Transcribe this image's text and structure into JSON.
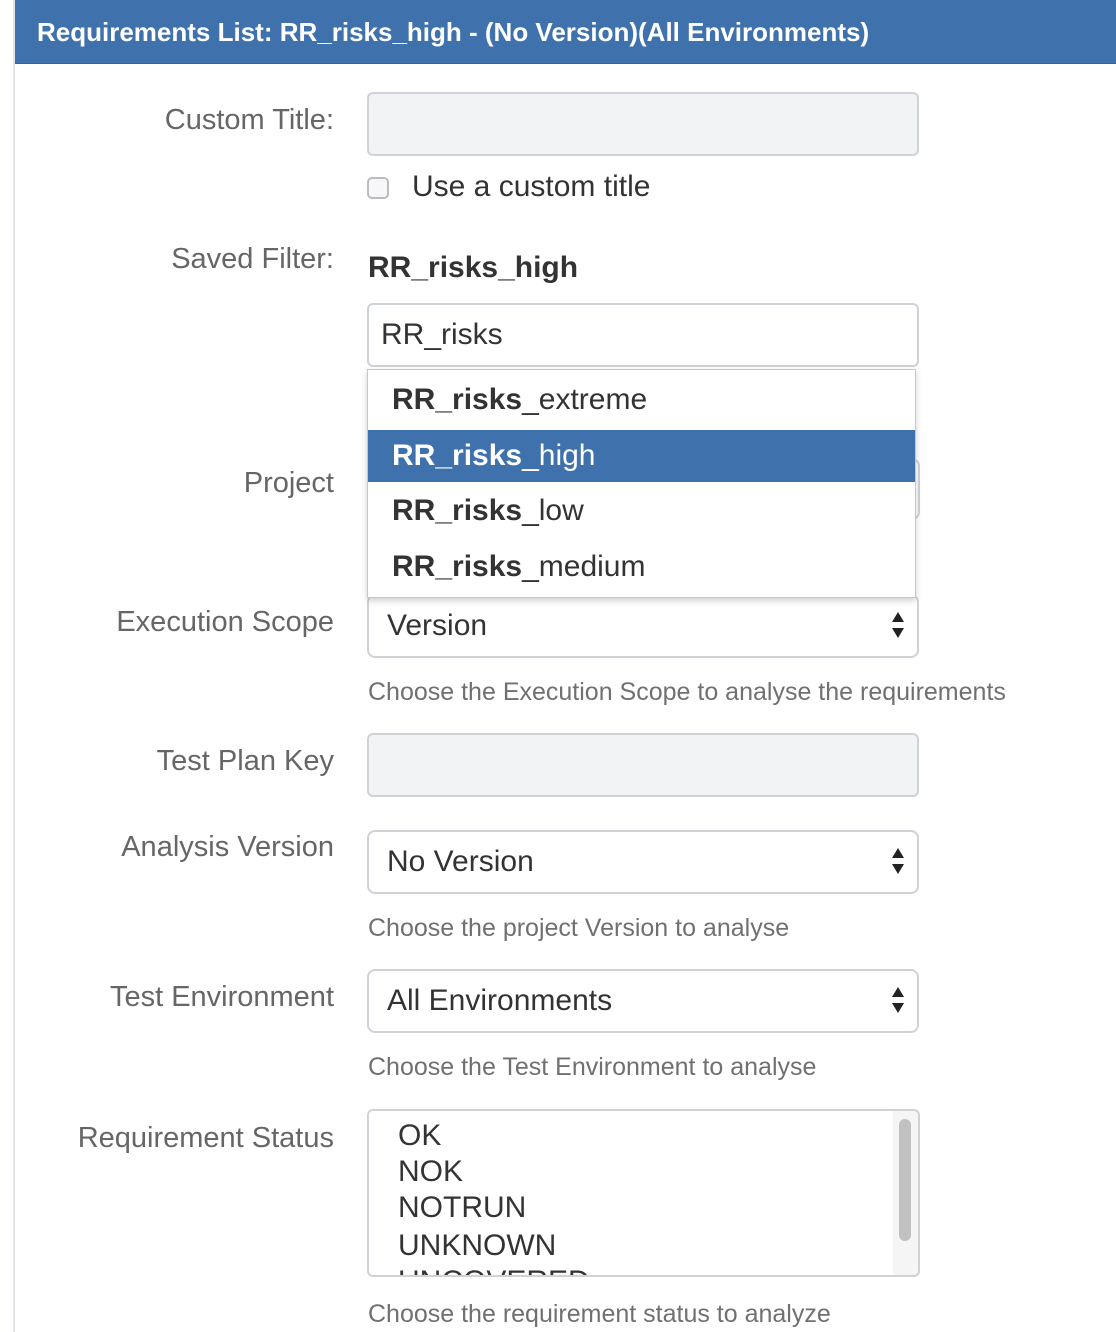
{
  "header": {
    "title": "Requirements List: RR_risks_high - (No Version)(All Environments)"
  },
  "custom_title": {
    "label": "Custom Title:",
    "value": "",
    "checkbox_label": "Use a custom title",
    "checked": false
  },
  "saved_filter": {
    "label": "Saved Filter:",
    "selected": "RR_risks_high",
    "input_value": "RR_risks",
    "suggestions": [
      {
        "match": "RR_risks",
        "rest": "_extreme",
        "active": false
      },
      {
        "match": "RR_risks",
        "rest": "_high",
        "active": true
      },
      {
        "match": "RR_risks",
        "rest": "_low",
        "active": false
      },
      {
        "match": "RR_risks",
        "rest": "_medium",
        "active": false
      }
    ]
  },
  "project": {
    "label": "Project"
  },
  "execution_scope": {
    "label": "Execution Scope",
    "selected": "Version",
    "help": "Choose the Execution Scope to analyse the requirements"
  },
  "test_plan_key": {
    "label": "Test Plan Key",
    "value": ""
  },
  "analysis_version": {
    "label": "Analysis Version",
    "selected": "No Version",
    "help": "Choose the project Version to analyse"
  },
  "test_environment": {
    "label": "Test Environment",
    "selected": "All Environments",
    "help": "Choose the Test Environment to analyse"
  },
  "requirement_status": {
    "label": "Requirement Status",
    "options": [
      "OK",
      "NOK",
      "NOTRUN",
      "UNKNOWN",
      "UNCOVERED"
    ],
    "help": "Choose the requirement status to analyze"
  },
  "colors": {
    "header": "#3f72ad",
    "active_item": "#3f72ad"
  }
}
